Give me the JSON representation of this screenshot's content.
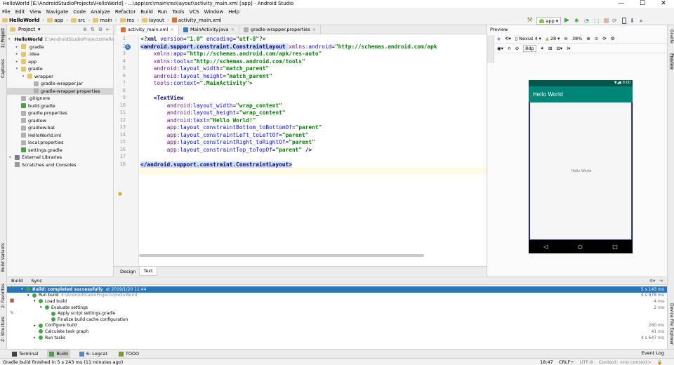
{
  "window": {
    "title": "HelloWorld [E:\\AndroidStudioProjects\\HelloWorld] - ...\\app\\src\\main\\res\\layout\\activity_main.xml [app] - Android Studio",
    "min": "—",
    "max": "☐",
    "close": "✕"
  },
  "menu": [
    "File",
    "Edit",
    "View",
    "Navigate",
    "Code",
    "Analyze",
    "Refactor",
    "Build",
    "Run",
    "Tools",
    "VCS",
    "Window",
    "Help"
  ],
  "breadcrumb": [
    "HelloWorld",
    "app",
    "src",
    "main",
    "res",
    "layout",
    "activity_main.xml"
  ],
  "run_config": "app",
  "left_strip": {
    "project": "1: Project",
    "captures": "Captures",
    "build_variants": "Build Variants",
    "favorites": "2: Favorites",
    "structure": "Z: Structure"
  },
  "right_strip": {
    "gradle": "Gradle",
    "preview": "Preview",
    "device_explorer": "Device File Explorer"
  },
  "project_panel": {
    "view": "Project",
    "tree": [
      {
        "label": "HelloWorld",
        "path": "E:\\AndroidStudioProjects\\HelloWorld",
        "depth": 0,
        "arrow": "▾",
        "icon": "folder"
      },
      {
        "label": ".gradle",
        "depth": 1,
        "arrow": "▸",
        "icon": "folder"
      },
      {
        "label": ".idea",
        "depth": 1,
        "arrow": "▸",
        "icon": "folder"
      },
      {
        "label": "app",
        "depth": 1,
        "arrow": "▸",
        "icon": "folder"
      },
      {
        "label": "gradle",
        "depth": 1,
        "arrow": "▾",
        "icon": "folder"
      },
      {
        "label": "wrapper",
        "depth": 2,
        "arrow": "▾",
        "icon": "folder"
      },
      {
        "label": "gradle-wrapper.jar",
        "depth": 3,
        "arrow": "",
        "icon": "file"
      },
      {
        "label": "gradle-wrapper.properties",
        "depth": 3,
        "arrow": "",
        "icon": "file",
        "selected": true
      },
      {
        "label": ".gitignore",
        "depth": 1,
        "arrow": "",
        "icon": "file"
      },
      {
        "label": "build.gradle",
        "depth": 1,
        "arrow": "",
        "icon": "gradle"
      },
      {
        "label": "gradle.properties",
        "depth": 1,
        "arrow": "",
        "icon": "file"
      },
      {
        "label": "gradlew",
        "depth": 1,
        "arrow": "",
        "icon": "file"
      },
      {
        "label": "gradlew.bat",
        "depth": 1,
        "arrow": "",
        "icon": "file"
      },
      {
        "label": "HelloWorld.iml",
        "depth": 1,
        "arrow": "",
        "icon": "file"
      },
      {
        "label": "local.properties",
        "depth": 1,
        "arrow": "",
        "icon": "file"
      },
      {
        "label": "settings.gradle",
        "depth": 1,
        "arrow": "",
        "icon": "gradle"
      },
      {
        "label": "External Libraries",
        "depth": 0,
        "arrow": "▸",
        "icon": "lib"
      },
      {
        "label": "Scratches and Consoles",
        "depth": 0,
        "arrow": "",
        "icon": "scratch"
      }
    ]
  },
  "editor": {
    "tabs": [
      {
        "label": "activity_main.xml",
        "active": true
      },
      {
        "label": "MainActivity.java",
        "active": false
      },
      {
        "label": "gradle-wrapper.properties",
        "active": false
      }
    ],
    "line_numbers": [
      "1",
      "2",
      "3",
      "4",
      "5",
      "6",
      "7",
      "8",
      "9",
      "10",
      "11",
      "12",
      "13",
      "14",
      "15",
      "16",
      "17",
      "18"
    ],
    "lines": [
      [
        [
          "pl",
          "<?"
        ],
        [
          "tg",
          "xml "
        ],
        [
          "an",
          "version"
        ],
        [
          "pl",
          "="
        ],
        [
          "av",
          "\"1.0\""
        ],
        [
          "an",
          " encoding"
        ],
        [
          "pl",
          "="
        ],
        [
          "av",
          "\"utf-8\""
        ],
        [
          "pl",
          "?>"
        ]
      ],
      [
        [
          "tg",
          "<android.support.constraint.ConstraintLayout "
        ],
        [
          "ns",
          "xmlns:"
        ],
        [
          "an",
          "android"
        ],
        [
          "pl",
          "="
        ],
        [
          "av",
          "\"http://schemas.android.com/apk"
        ]
      ],
      [
        [
          "pl",
          "    "
        ],
        [
          "ns",
          "xmlns:"
        ],
        [
          "an",
          "app"
        ],
        [
          "pl",
          "="
        ],
        [
          "av",
          "\"http://schemas.android.com/apk/res-auto\""
        ]
      ],
      [
        [
          "pl",
          "    "
        ],
        [
          "ns",
          "xmlns:"
        ],
        [
          "an",
          "tools"
        ],
        [
          "pl",
          "="
        ],
        [
          "av",
          "\"http://schemas.android.com/tools\""
        ]
      ],
      [
        [
          "pl",
          "    "
        ],
        [
          "ns",
          "android:"
        ],
        [
          "an",
          "layout_width"
        ],
        [
          "pl",
          "="
        ],
        [
          "av",
          "\"match_parent\""
        ]
      ],
      [
        [
          "pl",
          "    "
        ],
        [
          "ns",
          "android:"
        ],
        [
          "an",
          "layout_height"
        ],
        [
          "pl",
          "="
        ],
        [
          "av",
          "\"match_parent\""
        ]
      ],
      [
        [
          "pl",
          "    "
        ],
        [
          "ns",
          "tools:"
        ],
        [
          "an",
          "context"
        ],
        [
          "pl",
          "="
        ],
        [
          "av",
          "\".MainActivity\""
        ],
        [
          "pl",
          ">"
        ]
      ],
      [
        [
          "pl",
          ""
        ]
      ],
      [
        [
          "pl",
          "    "
        ],
        [
          "tg",
          "<TextView"
        ]
      ],
      [
        [
          "pl",
          "        "
        ],
        [
          "ns",
          "android:"
        ],
        [
          "an",
          "layout_width"
        ],
        [
          "pl",
          "="
        ],
        [
          "av",
          "\"wrap_content\""
        ]
      ],
      [
        [
          "pl",
          "        "
        ],
        [
          "ns",
          "android:"
        ],
        [
          "an",
          "layout_height"
        ],
        [
          "pl",
          "="
        ],
        [
          "av",
          "\"wrap_content\""
        ]
      ],
      [
        [
          "pl",
          "        "
        ],
        [
          "ns",
          "android:"
        ],
        [
          "an",
          "text"
        ],
        [
          "pl",
          "="
        ],
        [
          "av",
          "\"Hello World!\""
        ]
      ],
      [
        [
          "pl",
          "        "
        ],
        [
          "ns",
          "app:"
        ],
        [
          "an",
          "layout_constraintBottom_toBottomOf"
        ],
        [
          "pl",
          "="
        ],
        [
          "av",
          "\"parent\""
        ]
      ],
      [
        [
          "pl",
          "        "
        ],
        [
          "ns",
          "app:"
        ],
        [
          "an",
          "layout_constraintLeft_toLeftOf"
        ],
        [
          "pl",
          "="
        ],
        [
          "av",
          "\"parent\""
        ]
      ],
      [
        [
          "pl",
          "        "
        ],
        [
          "ns",
          "app:"
        ],
        [
          "an",
          "layout_constraintRight_toRightOf"
        ],
        [
          "pl",
          "="
        ],
        [
          "av",
          "\"parent\""
        ]
      ],
      [
        [
          "pl",
          "        "
        ],
        [
          "ns",
          "app:"
        ],
        [
          "an",
          "layout_constraintTop_toTopOf"
        ],
        [
          "pl",
          "="
        ],
        [
          "av",
          "\"parent\""
        ],
        [
          "tg",
          " />"
        ]
      ],
      [
        [
          "pl",
          ""
        ]
      ],
      [
        [
          "tg",
          "</android.support.constraint.ConstraintLayout>"
        ]
      ]
    ],
    "highlight_lines": [
      2,
      18
    ],
    "bottom_tabs": [
      {
        "label": "Design",
        "active": false
      },
      {
        "label": "Text",
        "active": true
      }
    ]
  },
  "preview": {
    "title": "Preview",
    "device": "Nexus 4",
    "api": "28",
    "zoom": "38%",
    "dp": "8dp",
    "phone": {
      "time": "8:00",
      "app_title": "Hello World",
      "content_text": "Hello World",
      "nav": [
        "◁",
        "○",
        "□"
      ]
    }
  },
  "build": {
    "tabs": [
      "Build",
      "Sync"
    ],
    "rows": [
      {
        "depth": 0,
        "text": "Build: completed successfully",
        "extra": "at 2019/1/20 11:44",
        "time": "5 s 143 ms",
        "selected": true,
        "arrow": "▾"
      },
      {
        "depth": 1,
        "text": "Run build",
        "extra": "E:\\AndroidStudioProjects\\HelloWorld",
        "time": "4 s 978 ms",
        "arrow": "▾"
      },
      {
        "depth": 2,
        "text": "Load build",
        "extra": "",
        "time": "4 ms",
        "arrow": "▾"
      },
      {
        "depth": 3,
        "text": "Evaluate settings",
        "extra": "",
        "time": "2 ms",
        "arrow": "▾"
      },
      {
        "depth": 4,
        "text": "Apply script settings.gradle",
        "extra": "",
        "time": "",
        "arrow": ""
      },
      {
        "depth": 4,
        "text": "Finalize build cache configuration",
        "extra": "",
        "time": "",
        "arrow": ""
      },
      {
        "depth": 2,
        "text": "Configure build",
        "extra": "",
        "time": "280 ms",
        "arrow": "▸"
      },
      {
        "depth": 2,
        "text": "Calculate task graph",
        "extra": "",
        "time": "41 ms",
        "arrow": ""
      },
      {
        "depth": 2,
        "text": "Run tasks",
        "extra": "",
        "time": "4 s 647 ms",
        "arrow": "▸"
      }
    ]
  },
  "bottom_tools": [
    {
      "label": "Terminal",
      "active": false
    },
    {
      "label": "Build",
      "active": true
    },
    {
      "label": "6: Logcat",
      "active": false
    },
    {
      "label": "TODO",
      "active": false
    }
  ],
  "event_log": "Event Log",
  "status": {
    "message": "Gradle build finished in 5 s 243 ms (11 minutes ago)",
    "position": "18:47",
    "line_sep": "CRLF÷",
    "encoding": "UTF-8",
    "context": "Context: <no context>"
  }
}
